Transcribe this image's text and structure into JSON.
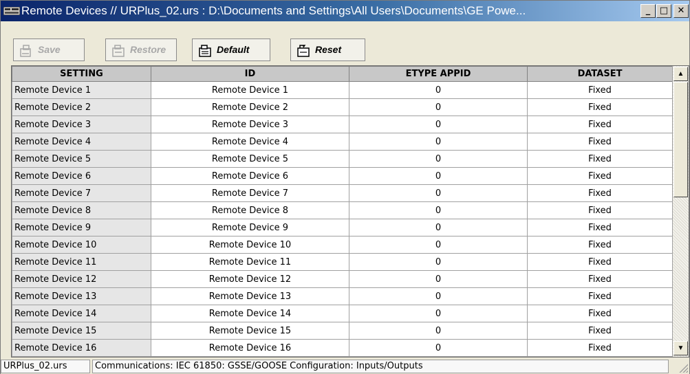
{
  "window": {
    "title": "Remote Devices // URPlus_02.urs : D:\\Documents and Settings\\All Users\\Documents\\GE Powe...",
    "minimize": "_",
    "maximize": "□",
    "close": "✕",
    "icon": "device-window-icon"
  },
  "toolbar": {
    "save_label": "Save",
    "restore_label": "Restore",
    "default_label": "Default",
    "reset_label": "Reset",
    "save_enabled": false,
    "restore_enabled": false
  },
  "grid": {
    "columns": [
      "SETTING",
      "ID",
      "ETYPE APPID",
      "DATASET"
    ],
    "rows": [
      {
        "setting": "Remote Device 1",
        "id": "Remote Device 1",
        "etype_appid": "0",
        "dataset": "Fixed"
      },
      {
        "setting": "Remote Device 2",
        "id": "Remote Device 2",
        "etype_appid": "0",
        "dataset": "Fixed"
      },
      {
        "setting": "Remote Device 3",
        "id": "Remote Device 3",
        "etype_appid": "0",
        "dataset": "Fixed"
      },
      {
        "setting": "Remote Device 4",
        "id": "Remote Device 4",
        "etype_appid": "0",
        "dataset": "Fixed"
      },
      {
        "setting": "Remote Device 5",
        "id": "Remote Device 5",
        "etype_appid": "0",
        "dataset": "Fixed"
      },
      {
        "setting": "Remote Device 6",
        "id": "Remote Device 6",
        "etype_appid": "0",
        "dataset": "Fixed"
      },
      {
        "setting": "Remote Device 7",
        "id": "Remote Device 7",
        "etype_appid": "0",
        "dataset": "Fixed"
      },
      {
        "setting": "Remote Device 8",
        "id": "Remote Device 8",
        "etype_appid": "0",
        "dataset": "Fixed"
      },
      {
        "setting": "Remote Device 9",
        "id": "Remote Device 9",
        "etype_appid": "0",
        "dataset": "Fixed"
      },
      {
        "setting": "Remote Device 10",
        "id": "Remote Device 10",
        "etype_appid": "0",
        "dataset": "Fixed"
      },
      {
        "setting": "Remote Device 11",
        "id": "Remote Device 11",
        "etype_appid": "0",
        "dataset": "Fixed"
      },
      {
        "setting": "Remote Device 12",
        "id": "Remote Device 12",
        "etype_appid": "0",
        "dataset": "Fixed"
      },
      {
        "setting": "Remote Device 13",
        "id": "Remote Device 13",
        "etype_appid": "0",
        "dataset": "Fixed"
      },
      {
        "setting": "Remote Device 14",
        "id": "Remote Device 14",
        "etype_appid": "0",
        "dataset": "Fixed"
      },
      {
        "setting": "Remote Device 15",
        "id": "Remote Device 15",
        "etype_appid": "0",
        "dataset": "Fixed"
      },
      {
        "setting": "Remote Device 16",
        "id": "Remote Device 16",
        "etype_appid": "0",
        "dataset": "Fixed"
      }
    ]
  },
  "scrollbar": {
    "up": "▲",
    "down": "▼"
  },
  "statusbar": {
    "file": "URPlus_02.urs",
    "path": "Communications: IEC 61850: GSSE/GOOSE Configuration: Inputs/Outputs"
  },
  "colors": {
    "titlebar_start": "#0a246a",
    "titlebar_end": "#a6caf0",
    "header_bg": "#c8c8c8",
    "setting_cell_bg": "#e6e6e6",
    "window_bg": "#ece9d8"
  }
}
